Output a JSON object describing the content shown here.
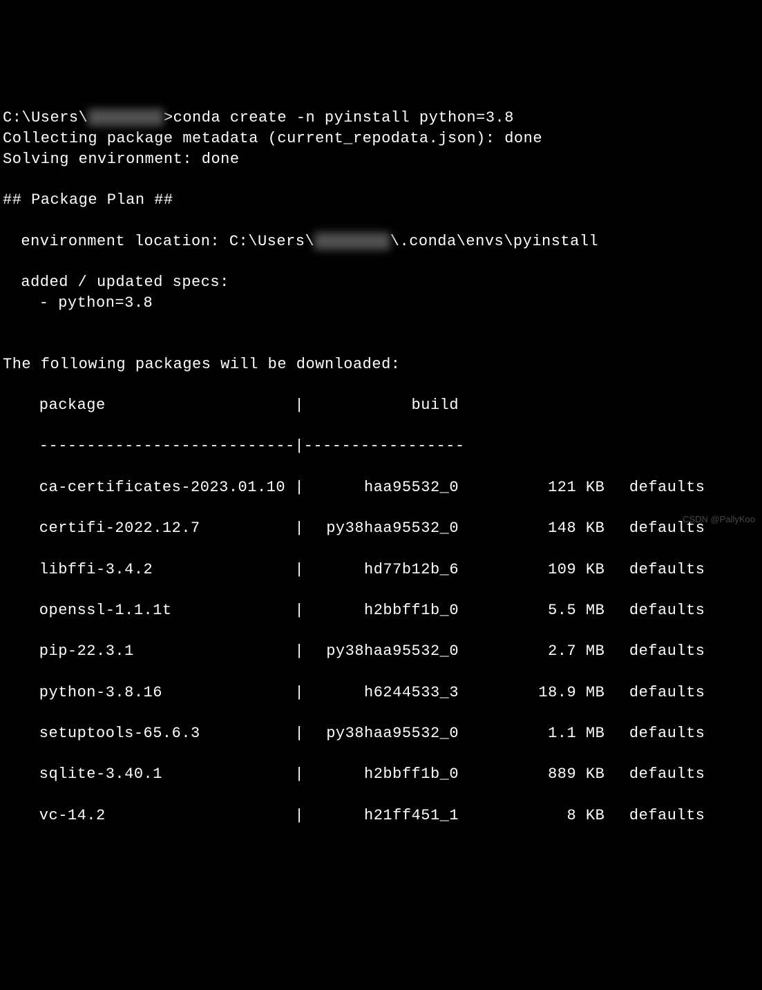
{
  "prompt": {
    "prefix": "C:\\Users\\",
    "redacted": "████████",
    "suffix": ">",
    "command": "conda create -n pyinstall python=3.8"
  },
  "status": {
    "collecting": "Collecting package metadata (current_repodata.json): done",
    "solving": "Solving environment: done"
  },
  "plan": {
    "header": "## Package Plan ##",
    "env_label": "environment location: C:\\Users\\",
    "env_redacted": "████████",
    "env_suffix": "\\.conda\\envs\\pyinstall",
    "specs_label": "added / updated specs:",
    "spec_item": "- python=3.8"
  },
  "download": {
    "header": "The following packages will be downloaded:",
    "col_package": "package",
    "col_build": "build",
    "divider_left": "---------------------------",
    "divider_sep": "|",
    "divider_right": "-----------------"
  },
  "packages": [
    {
      "name": "ca-certificates-2023.01.10",
      "build": "haa95532_0",
      "size": "121 KB",
      "channel": "defaults"
    },
    {
      "name": "certifi-2022.12.7",
      "build": "py38haa95532_0",
      "size": "148 KB",
      "channel": "defaults"
    },
    {
      "name": "libffi-3.4.2",
      "build": "hd77b12b_6",
      "size": "109 KB",
      "channel": "defaults"
    },
    {
      "name": "openssl-1.1.1t",
      "build": "h2bbff1b_0",
      "size": "5.5 MB",
      "channel": "defaults"
    },
    {
      "name": "pip-22.3.1",
      "build": "py38haa95532_0",
      "size": "2.7 MB",
      "channel": "defaults"
    },
    {
      "name": "python-3.8.16",
      "build": "h6244533_3",
      "size": "18.9 MB",
      "channel": "defaults"
    },
    {
      "name": "setuptools-65.6.3",
      "build": "py38haa95532_0",
      "size": "1.1 MB",
      "channel": "defaults"
    },
    {
      "name": "sqlite-3.40.1",
      "build": "h2bbff1b_0",
      "size": "889 KB",
      "channel": "defaults"
    },
    {
      "name": "vc-14.2",
      "build": "h21ff451_1",
      "size": "8 KB",
      "channel": "defaults"
    }
  ],
  "watermark": "CSDN @PallyKoo"
}
